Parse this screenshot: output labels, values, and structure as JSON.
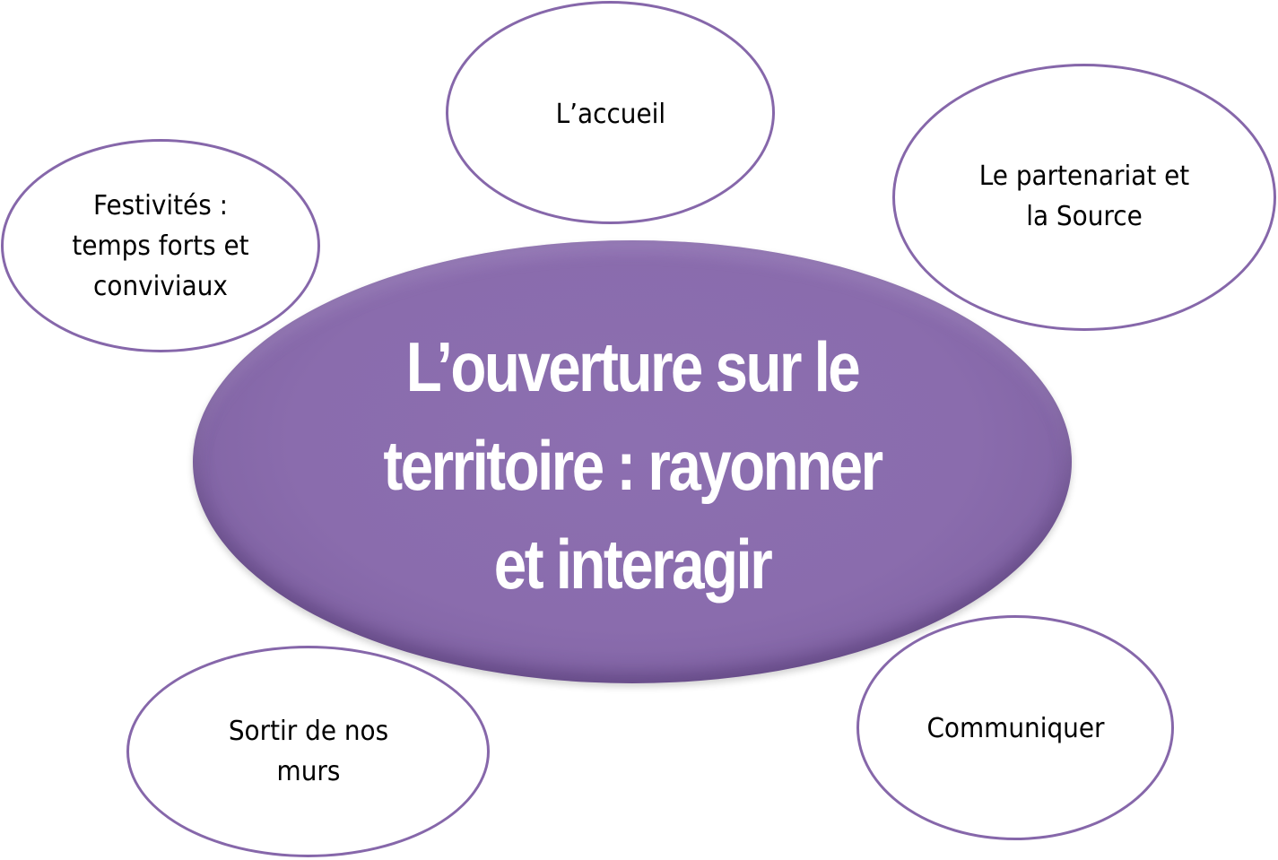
{
  "center": {
    "lines": [
      "L’ouverture sur le",
      "territoire : rayonner",
      "et interagir"
    ],
    "fill_color": "#8a6cad",
    "text_color": "#ffffff"
  },
  "bubbles": {
    "accueil": {
      "lines": [
        "L’accueil"
      ]
    },
    "festivites": {
      "lines": [
        "Festivités :",
        "temps forts et",
        "conviviaux"
      ]
    },
    "partenariat": {
      "lines": [
        "Le partenariat et",
        "la Source"
      ]
    },
    "sortir": {
      "lines": [
        "Sortir de nos",
        "murs"
      ]
    },
    "communiquer": {
      "lines": [
        "Communiquer"
      ]
    },
    "border_color": "#8667aa"
  }
}
